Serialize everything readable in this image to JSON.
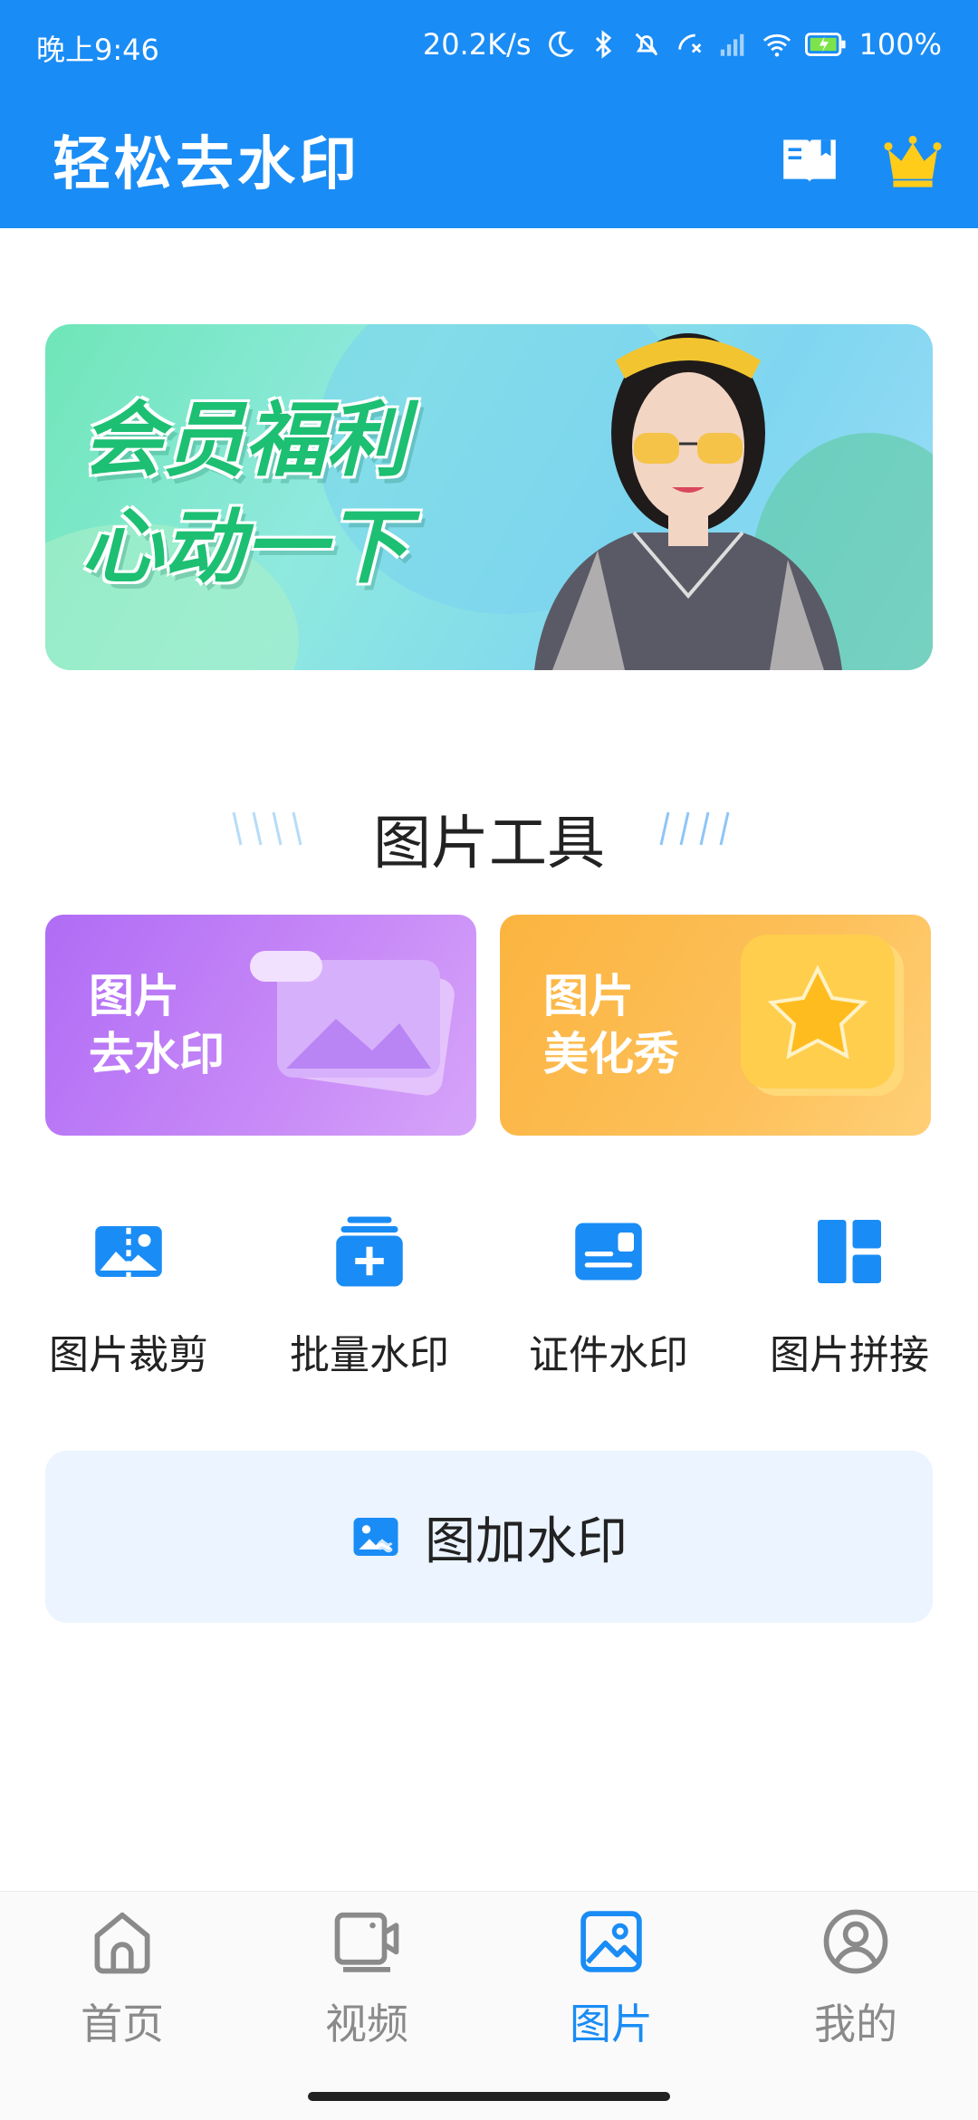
{
  "status_bar": {
    "time": "晚上9:46",
    "network_speed": "20.2K/s",
    "battery": "100%",
    "icons": [
      "moon-icon",
      "bluetooth-icon",
      "mute-icon",
      "call-forward-icon",
      "signal-icon",
      "wifi-icon",
      "battery-charging-icon"
    ]
  },
  "header": {
    "title": "轻松去水印",
    "book_icon": "book-icon",
    "crown_icon": "crown-icon",
    "accent_color": "#1a8cf5"
  },
  "banner": {
    "line1": "会员福利",
    "line2": "心动一下"
  },
  "section": {
    "title": "图片工具"
  },
  "cards": [
    {
      "line1": "图片",
      "line2": "去水印",
      "color": "#b06cf5"
    },
    {
      "line1": "图片",
      "line2": "美化秀",
      "color": "#fbb43f"
    }
  ],
  "tools": [
    {
      "label": "图片裁剪",
      "icon": "crop-image-icon"
    },
    {
      "label": "批量水印",
      "icon": "batch-add-icon"
    },
    {
      "label": "证件水印",
      "icon": "id-card-icon"
    },
    {
      "label": "图片拼接",
      "icon": "collage-icon"
    }
  ],
  "add_watermark": {
    "label": "图加水印",
    "icon": "image-watermark-icon"
  },
  "bottom_nav": {
    "items": [
      {
        "label": "首页",
        "icon": "home-icon",
        "active": false
      },
      {
        "label": "视频",
        "icon": "video-icon",
        "active": false
      },
      {
        "label": "图片",
        "icon": "image-icon",
        "active": true
      },
      {
        "label": "我的",
        "icon": "profile-icon",
        "active": false
      }
    ],
    "active_color": "#1a8cf5",
    "inactive_color": "#8a8a8a"
  }
}
